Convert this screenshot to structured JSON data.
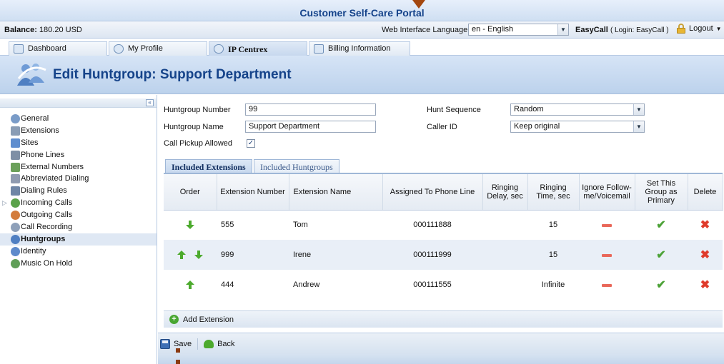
{
  "portal": {
    "title": "Customer Self-Care Portal"
  },
  "infobar": {
    "balance_label": "Balance:",
    "balance_value": "180.20 USD",
    "language_label": "Web Interface Language:",
    "language_value": "en - English",
    "user_name": "EasyCall",
    "login_text": "( Login: EasyCall )",
    "logout_label": "Logout"
  },
  "tabs": [
    {
      "label": "Dashboard"
    },
    {
      "label": "My Profile"
    },
    {
      "label": "IP Centrex"
    },
    {
      "label": "Billing Information"
    }
  ],
  "header": {
    "title": "Edit Huntgroup: Support Department"
  },
  "sidebar": {
    "collapse_label": "«",
    "items": [
      {
        "label": "General",
        "icon": "gear-icon",
        "color": "#7a9cc8"
      },
      {
        "label": "Extensions",
        "icon": "extensions-icon",
        "color": "#8a9db5"
      },
      {
        "label": "Sites",
        "icon": "sites-icon",
        "color": "#5f8ecf"
      },
      {
        "label": "Phone Lines",
        "icon": "phone-lines-icon",
        "color": "#7e8fa5"
      },
      {
        "label": "External Numbers",
        "icon": "external-numbers-icon",
        "color": "#6ba05a"
      },
      {
        "label": "Abbreviated Dialing",
        "icon": "abbreviated-dialing-icon",
        "color": "#8f9bb0"
      },
      {
        "label": "Dialing Rules",
        "icon": "dialing-rules-icon",
        "color": "#6f86a6"
      },
      {
        "label": "Incoming Calls",
        "icon": "incoming-calls-icon",
        "color": "#5aa24a"
      },
      {
        "label": "Outgoing Calls",
        "icon": "outgoing-calls-icon",
        "color": "#d37c3c"
      },
      {
        "label": "Call Recording",
        "icon": "call-recording-icon",
        "color": "#8ea0b9"
      },
      {
        "label": "Huntgroups",
        "icon": "huntgroups-icon",
        "color": "#4f7fc2"
      },
      {
        "label": "Identity",
        "icon": "identity-icon",
        "color": "#5d8acb"
      },
      {
        "label": "Music On Hold",
        "icon": "music-on-hold-icon",
        "color": "#5f9e57"
      }
    ]
  },
  "form": {
    "huntgroup_number_label": "Huntgroup Number",
    "huntgroup_number_value": "99",
    "huntgroup_name_label": "Huntgroup Name",
    "huntgroup_name_value": "Support Department",
    "call_pickup_label": "Call Pickup Allowed",
    "call_pickup_checked": true,
    "hunt_sequence_label": "Hunt Sequence",
    "hunt_sequence_value": "Random",
    "caller_id_label": "Caller ID",
    "caller_id_value": "Keep original"
  },
  "inner_tabs": [
    {
      "label": "Included Extensions"
    },
    {
      "label": "Included Huntgroups"
    }
  ],
  "grid": {
    "columns": [
      "Order",
      "Extension Number",
      "Extension Name",
      "Assigned To Phone Line",
      "Ringing Delay, sec",
      "Ringing Time, sec",
      "Ignore Follow-me/Voicemail",
      "Set This Group as Primary",
      "Delete"
    ],
    "rows": [
      {
        "order": [
          "down"
        ],
        "number": "555",
        "name": "Tom",
        "phone_line": "000111888",
        "ringing_delay": "",
        "ringing_time": "15"
      },
      {
        "order": [
          "up",
          "down"
        ],
        "number": "999",
        "name": "Irene",
        "phone_line": "000111999",
        "ringing_delay": "",
        "ringing_time": "15"
      },
      {
        "order": [
          "up"
        ],
        "number": "444",
        "name": "Andrew",
        "phone_line": "000111555",
        "ringing_delay": "",
        "ringing_time": "Infinite"
      }
    ]
  },
  "actions": {
    "add_extension_label": "Add Extension",
    "save_label": "Save",
    "back_label": "Back"
  },
  "colors": {
    "title_blue": "#15438a",
    "arrow_marker": "#a3470f",
    "green": "#4caa2d",
    "red": "#df3b2b"
  }
}
